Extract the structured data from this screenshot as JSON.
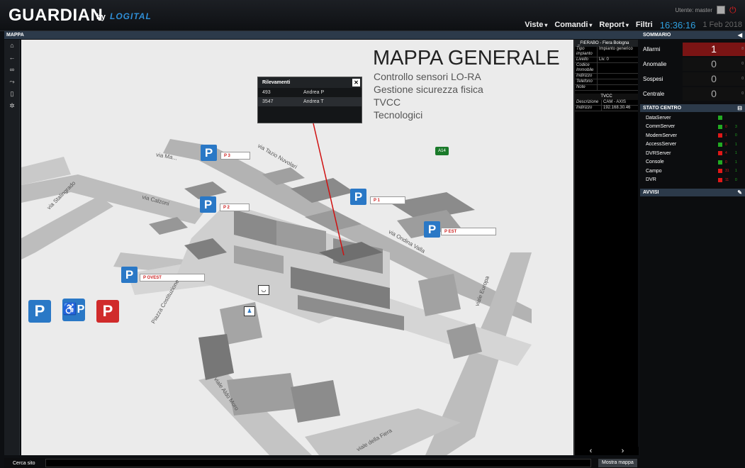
{
  "header": {
    "logo": "GUARDIAN",
    "logo_by": "by",
    "logo_brand": "LOGITAL",
    "user": "Utente: master",
    "menu": [
      {
        "label": "Viste",
        "caret": "▾"
      },
      {
        "label": "Comandi",
        "caret": "▾"
      },
      {
        "label": "Report",
        "caret": "▾"
      },
      {
        "label": "Filtri",
        "caret": ""
      }
    ],
    "clock": "16:36:16",
    "date": "1 Feb 2018"
  },
  "left_panel": {
    "title": "MAPPA"
  },
  "sidebar": {
    "icons": [
      "home-icon",
      "back-icon",
      "link-icon",
      "route-icon",
      "document-icon",
      "gear-icon"
    ]
  },
  "map": {
    "title": "MAPPA GENERALE",
    "subtitles": [
      "Controllo sensori LO-RA",
      "Gestione sicurezza fisica",
      "TVCC",
      "Tecnologici"
    ],
    "parkings": [
      {
        "badge": "P",
        "label": "P 3"
      },
      {
        "badge": "P",
        "label": "P 2"
      },
      {
        "badge": "P",
        "label": "P 1"
      },
      {
        "badge": "P",
        "label": "P EST"
      },
      {
        "badge": "P",
        "label": "P OVEST"
      }
    ],
    "legend": {
      "p_blue": "P",
      "disabled": "♿P",
      "p_red": "P"
    },
    "streets": [
      "via Tazio Nuvolari",
      "via Calzoni",
      "via Stalingrado",
      "via Ondina Valla",
      "viale Europa",
      "Piazza Costituzione",
      "viale Aldo Moro",
      "viale della Fiera",
      "via Ma..."
    ],
    "highway_sign": "A14",
    "colors": {
      "parking_blue": "#2a78c6",
      "parking_red": "#d02b2b",
      "connector_line": "#d01010"
    }
  },
  "popup": {
    "title": "Rilevamenti",
    "close": "✕",
    "rows": [
      {
        "id": "493",
        "name": "Andrea P"
      },
      {
        "id": "3547",
        "name": "Andrea T"
      }
    ]
  },
  "info_panel": {
    "title": "_FIERABO - Fiera Bologna",
    "rows": [
      {
        "k": "Tipo impianto",
        "v": "Impianto generico"
      },
      {
        "k": "Livello",
        "v": "Liv. 0"
      },
      {
        "k": "Codice Immobile",
        "v": ""
      },
      {
        "k": "Indirizzo",
        "v": ""
      },
      {
        "k": "Telefono",
        "v": ""
      },
      {
        "k": "Note",
        "v": ""
      }
    ],
    "tvcc_title": "TVCC",
    "tvcc_rows": [
      {
        "k": "Descrizione",
        "v": "CAM - AXIS"
      },
      {
        "k": "Indirizzo",
        "v": "192.168.30.46"
      }
    ],
    "prev": "‹",
    "next": "›"
  },
  "sommario": {
    "title": "SOMMARIO",
    "rows": [
      {
        "label": "Allarmi",
        "value": "1",
        "small": "8"
      },
      {
        "label": "Anomalie",
        "value": "0",
        "small": "0"
      },
      {
        "label": "Sospesi",
        "value": "0",
        "small": "0"
      },
      {
        "label": "Centrale",
        "value": "0",
        "small": "0"
      }
    ]
  },
  "stato_centro": {
    "title": "STATO CENTRO",
    "rows": [
      {
        "name": "DataServer",
        "status": "ok",
        "c1": "",
        "c2": ""
      },
      {
        "name": "CommServer",
        "status": "ok",
        "c1": "0",
        "c2": "3"
      },
      {
        "name": "ModemServer",
        "status": "err",
        "c1": "1",
        "c2": "0"
      },
      {
        "name": "AccessServer",
        "status": "ok",
        "c1": "0",
        "c2": "1"
      },
      {
        "name": "DVRServer",
        "status": "err",
        "c1": "4",
        "c2": "1"
      },
      {
        "name": "Console",
        "status": "ok",
        "c1": "0",
        "c2": "1"
      },
      {
        "name": "Campo",
        "status": "err",
        "c1": "31",
        "c2": "1"
      },
      {
        "name": "DVR",
        "status": "err",
        "c1": "11",
        "c2": "0"
      }
    ]
  },
  "avvisi": {
    "title": "AVVISI"
  },
  "bottom": {
    "search_label": "Cerca sito",
    "search_value": "",
    "show_map": "Mostra mappa"
  }
}
